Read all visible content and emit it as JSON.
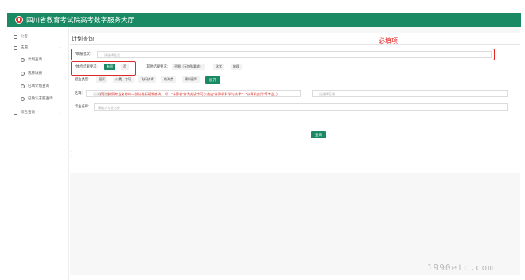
{
  "header": {
    "title": "四川省教育考试院高考数字服务大厅"
  },
  "sidebar": {
    "items": [
      {
        "label": "公告"
      },
      {
        "label": "志愿"
      },
      {
        "label": "计划查询"
      },
      {
        "label": "志愿填报"
      },
      {
        "label": "已填计划查询"
      },
      {
        "label": "已确认志愿查询"
      },
      {
        "label": "综合查询"
      }
    ]
  },
  "main": {
    "page_title": "计划查询",
    "annotation": "必填项",
    "school_field": {
      "label": "*填报批次:",
      "placeholder": "---请选择批次---"
    },
    "exempt_field": {
      "label": "*体检结果要求:",
      "options": [
        "有限",
        "否"
      ]
    },
    "other_field": {
      "label": "其他结果要求:",
      "options": [
        "不限（无特殊要求）",
        "化学",
        "地理"
      ]
    },
    "plan_type": {
      "label": "招生类型:",
      "options": [
        "国家",
        "公费、专项",
        "飞行技术",
        "航海类",
        "预科班等"
      ],
      "expand_label": "展开"
    },
    "region": {
      "label": "区域:",
      "placeholder1": "---请选择区域---",
      "placeholder2": "---请选择区域---"
    },
    "major": {
      "label": "专业名称:",
      "placeholder": "请输入专业名称"
    },
    "hint": "(可以按照专业名称的一部分进行模糊查询，如：“计算机”作为关键字可以查出“计算机科学与技术”，“计算机应用”等专业。)",
    "query_button": "查询"
  },
  "watermark": "1990etc.com",
  "colors": {
    "brand": "#1a8a64",
    "annotation": "#e32626"
  }
}
